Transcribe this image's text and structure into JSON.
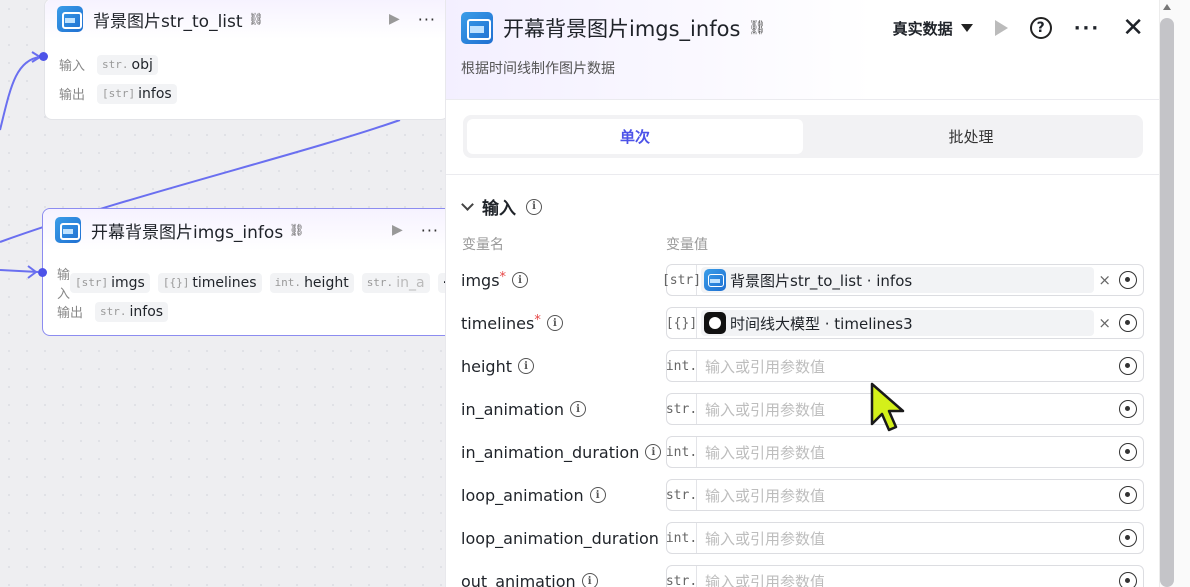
{
  "canvas": {
    "node1": {
      "title": "背景图片str_to_list",
      "input_label": "输入",
      "output_label": "输出",
      "inputs": [
        {
          "type": "str.",
          "name": "obj"
        }
      ],
      "outputs": [
        {
          "type": "[str]",
          "name": "infos"
        }
      ]
    },
    "node2": {
      "title": "开幕背景图片imgs_infos",
      "input_label": "输入",
      "output_label": "输出",
      "inputs": [
        {
          "type": "[str]",
          "name": "imgs"
        },
        {
          "type": "[{}]",
          "name": "timelines"
        },
        {
          "type": "int.",
          "name": "height"
        },
        {
          "type": "str.",
          "name": "in_a"
        }
      ],
      "overflow": "···",
      "outputs": [
        {
          "type": "str.",
          "name": "infos"
        }
      ]
    }
  },
  "panel": {
    "title": "开幕背景图片imgs_infos",
    "description": "根据时间线制作图片数据",
    "mode": "真实数据",
    "help": "?",
    "more": "···",
    "close": "✕",
    "tabs": [
      {
        "label": "单次"
      },
      {
        "label": "批处理"
      }
    ],
    "section": "输入",
    "col_name": "变量名",
    "col_value": "变量值",
    "clear": "×",
    "params": [
      {
        "name": "imgs",
        "required": "*",
        "type": "[str]",
        "value": "背景图片str_to_list · infos",
        "kind": "ref-blue"
      },
      {
        "name": "timelines",
        "required": "*",
        "type": "[{}]",
        "value": "时间线大模型 · timelines3",
        "kind": "ref-black"
      },
      {
        "name": "height",
        "required": "",
        "type": "int.",
        "placeholder": "输入或引用参数值"
      },
      {
        "name": "in_animation",
        "required": "",
        "type": "str.",
        "placeholder": "输入或引用参数值"
      },
      {
        "name": "in_animation_duration",
        "required": "",
        "type": "int.",
        "placeholder": "输入或引用参数值"
      },
      {
        "name": "loop_animation",
        "required": "",
        "type": "str.",
        "placeholder": "输入或引用参数值"
      },
      {
        "name": "loop_animation_duration",
        "required": "",
        "type": "int.",
        "placeholder": "输入或引用参数值"
      },
      {
        "name": "out_animation",
        "required": "",
        "type": "str.",
        "placeholder": "输入或引用参数值"
      }
    ]
  },
  "colors": {
    "accent": "#4d53e8",
    "required": "#e64545",
    "cursor": "#d4f01a"
  }
}
